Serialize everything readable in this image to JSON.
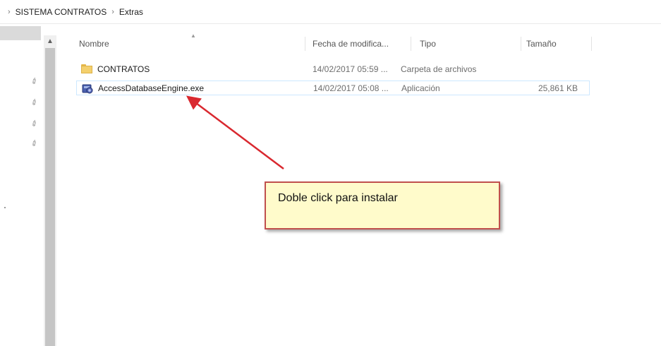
{
  "breadcrumb": {
    "separator": "›",
    "items": [
      "SISTEMA CONTRATOS",
      "Extras"
    ]
  },
  "columns": {
    "name": "Nombre",
    "date": "Fecha de modifica...",
    "type": "Tipo",
    "size": "Tamaño"
  },
  "files": [
    {
      "name": "CONTRATOS",
      "date": "14/02/2017 05:59 ...",
      "type": "Carpeta de archivos",
      "size": "",
      "icon": "folder-icon"
    },
    {
      "name": "AccessDatabaseEngine.exe",
      "date": "14/02/2017 05:08 ...",
      "type": "Aplicación",
      "size": "25,861 KB",
      "icon": "application-icon"
    }
  ],
  "callout": {
    "text": "Doble click para instalar"
  },
  "colors": {
    "callout_fill": "#fffbcb",
    "callout_border": "#c0504d",
    "arrow": "#d9282f",
    "folder": "#f4d06d",
    "selection_border": "#cde8ff"
  }
}
